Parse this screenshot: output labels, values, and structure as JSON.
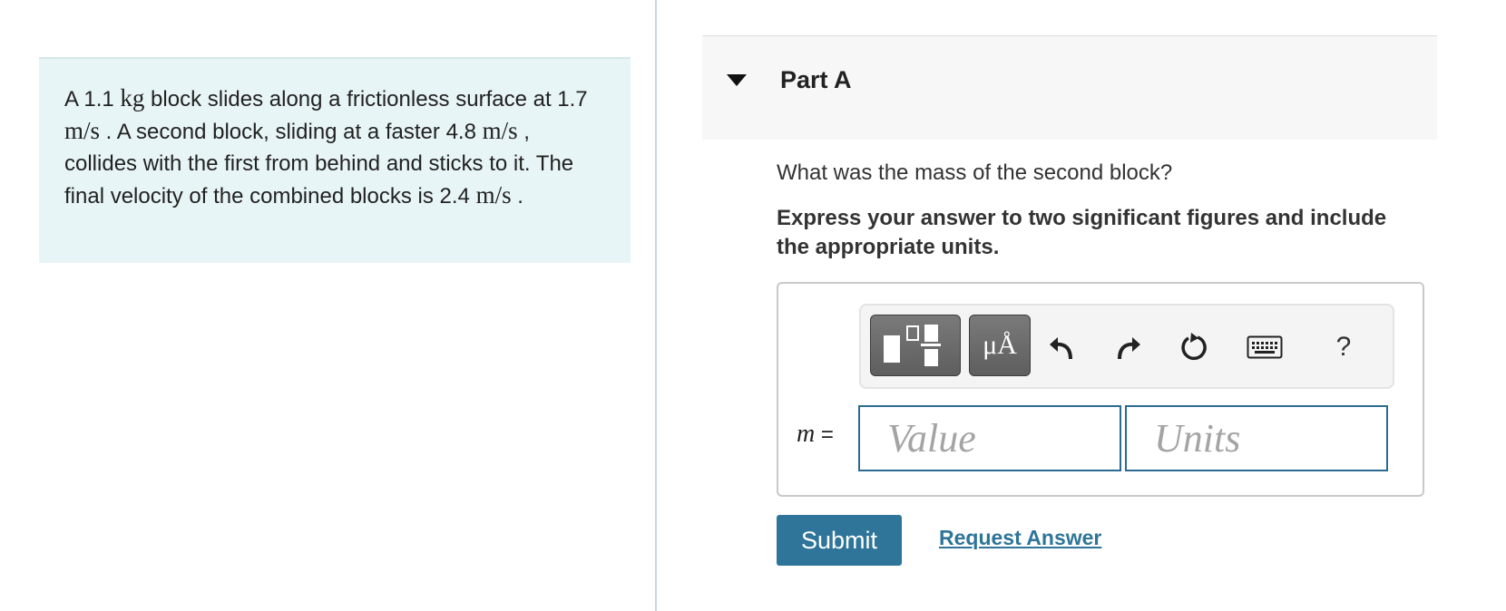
{
  "problem": {
    "t1": "A 1.1 ",
    "u1": "kg",
    "t2": " block slides along a frictionless surface at 1.7 ",
    "u2": "m/s",
    "t3": " . A second block, sliding at a faster 4.8 ",
    "u3": "m/s",
    "t4": " , collides with the first from behind and sticks to it. The final velocity of the combined blocks is 2.4 ",
    "u4": "m/s",
    "t5": " ."
  },
  "part": {
    "title": "Part A"
  },
  "question": "What was the mass of the second block?",
  "instruction": "Express your answer to two significant figures and include the appropriate units.",
  "toolbar": {
    "units_symbol": "μÅ",
    "help": "?"
  },
  "answer": {
    "variable": "m",
    "equals": " =",
    "value_placeholder": "Value",
    "units_placeholder": "Units"
  },
  "actions": {
    "submit": "Submit",
    "request": "Request Answer"
  },
  "colors": {
    "accent": "#2e7599",
    "problem_bg": "#e8f5f7",
    "header_bg": "#f7f7f7"
  }
}
